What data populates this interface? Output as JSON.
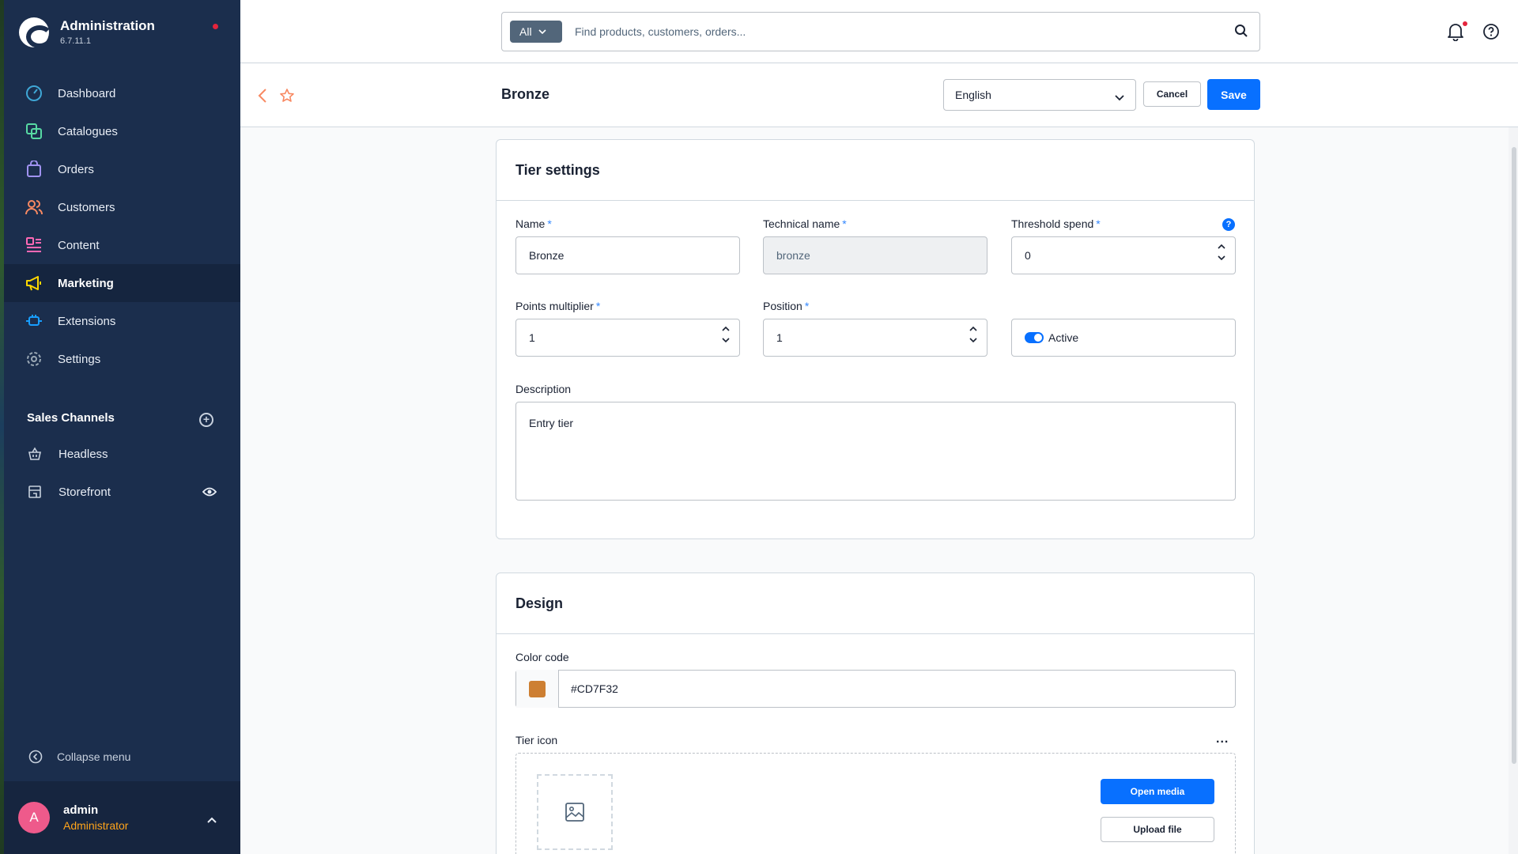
{
  "app": {
    "title": "Administration",
    "version": "6.7.11.1"
  },
  "sidebar": {
    "items": [
      {
        "label": "Dashboard",
        "icon": "dashboard-icon",
        "color": "#3fa7d6"
      },
      {
        "label": "Catalogues",
        "icon": "catalogue-icon",
        "color": "#57d9a3"
      },
      {
        "label": "Orders",
        "icon": "orders-icon",
        "color": "#a092f0"
      },
      {
        "label": "Customers",
        "icon": "customers-icon",
        "color": "#f88962"
      },
      {
        "label": "Content",
        "icon": "content-icon",
        "color": "#ff68b4"
      },
      {
        "label": "Marketing",
        "icon": "marketing-icon",
        "color": "#ffd700"
      },
      {
        "label": "Extensions",
        "icon": "extensions-icon",
        "color": "#189eff"
      },
      {
        "label": "Settings",
        "icon": "settings-icon",
        "color": "#9aa8b5"
      }
    ],
    "active": "Marketing",
    "sales_channels_title": "Sales Channels",
    "sales_channels": [
      {
        "label": "Headless",
        "icon": "basket-icon"
      },
      {
        "label": "Storefront",
        "icon": "storefront-icon"
      }
    ],
    "collapse_label": "Collapse menu",
    "user": {
      "initial": "A",
      "name": "admin",
      "role": "Administrator"
    }
  },
  "topbar": {
    "search_type": "All",
    "search_placeholder": "Find products, customers, orders..."
  },
  "smartbar": {
    "title": "Bronze",
    "language": "English",
    "cancel_label": "Cancel",
    "save_label": "Save"
  },
  "tier_settings": {
    "title": "Tier settings",
    "name_label": "Name",
    "name_value": "Bronze",
    "technical_label": "Technical name",
    "technical_value": "bronze",
    "threshold_label": "Threshold spend",
    "threshold_value": "0",
    "multiplier_label": "Points multiplier",
    "multiplier_value": "1",
    "position_label": "Position",
    "position_value": "1",
    "active_label": "Active",
    "active": true,
    "description_label": "Description",
    "description_value": "Entry tier",
    "required_mark": "*",
    "help_mark": "?"
  },
  "design": {
    "title": "Design",
    "color_label": "Color code",
    "color_value": "#CD7F32",
    "icon_label": "Tier icon",
    "more_label": "...",
    "open_media_label": "Open media",
    "upload_label": "Upload file"
  },
  "colors": {
    "sidebar_bg": "#1b2e4d",
    "accent": "#0870ff",
    "tier_color": "#cd7f32",
    "role_color": "#ffa41b"
  }
}
